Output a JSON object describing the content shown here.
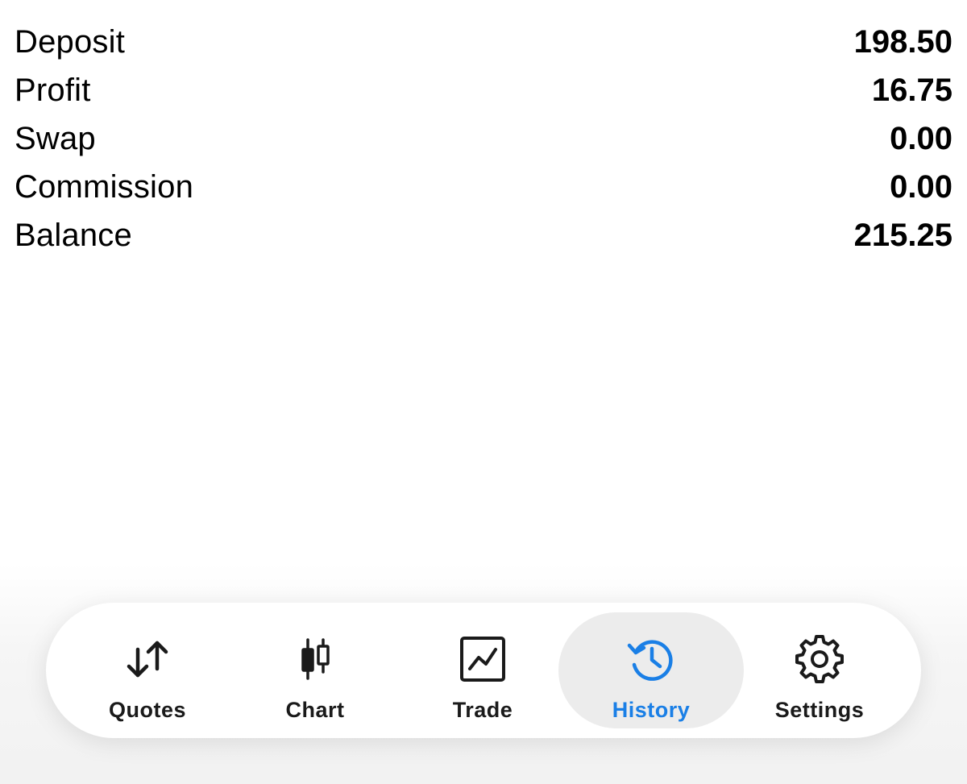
{
  "summary": {
    "rows": [
      {
        "label": "Deposit",
        "value": "198.50"
      },
      {
        "label": "Profit",
        "value": "16.75"
      },
      {
        "label": "Swap",
        "value": "0.00"
      },
      {
        "label": "Commission",
        "value": "0.00"
      },
      {
        "label": "Balance",
        "value": "215.25"
      }
    ]
  },
  "tabbar": {
    "active_color": "#1a7fe6",
    "tabs": [
      {
        "label": "Quotes",
        "icon": "arrows-up-down-icon",
        "active": false
      },
      {
        "label": "Chart",
        "icon": "candlestick-chart-icon",
        "active": false
      },
      {
        "label": "Trade",
        "icon": "trade-line-chart-icon",
        "active": false
      },
      {
        "label": "History",
        "icon": "history-clock-icon",
        "active": true
      },
      {
        "label": "Settings",
        "icon": "gear-icon",
        "active": false
      }
    ]
  }
}
